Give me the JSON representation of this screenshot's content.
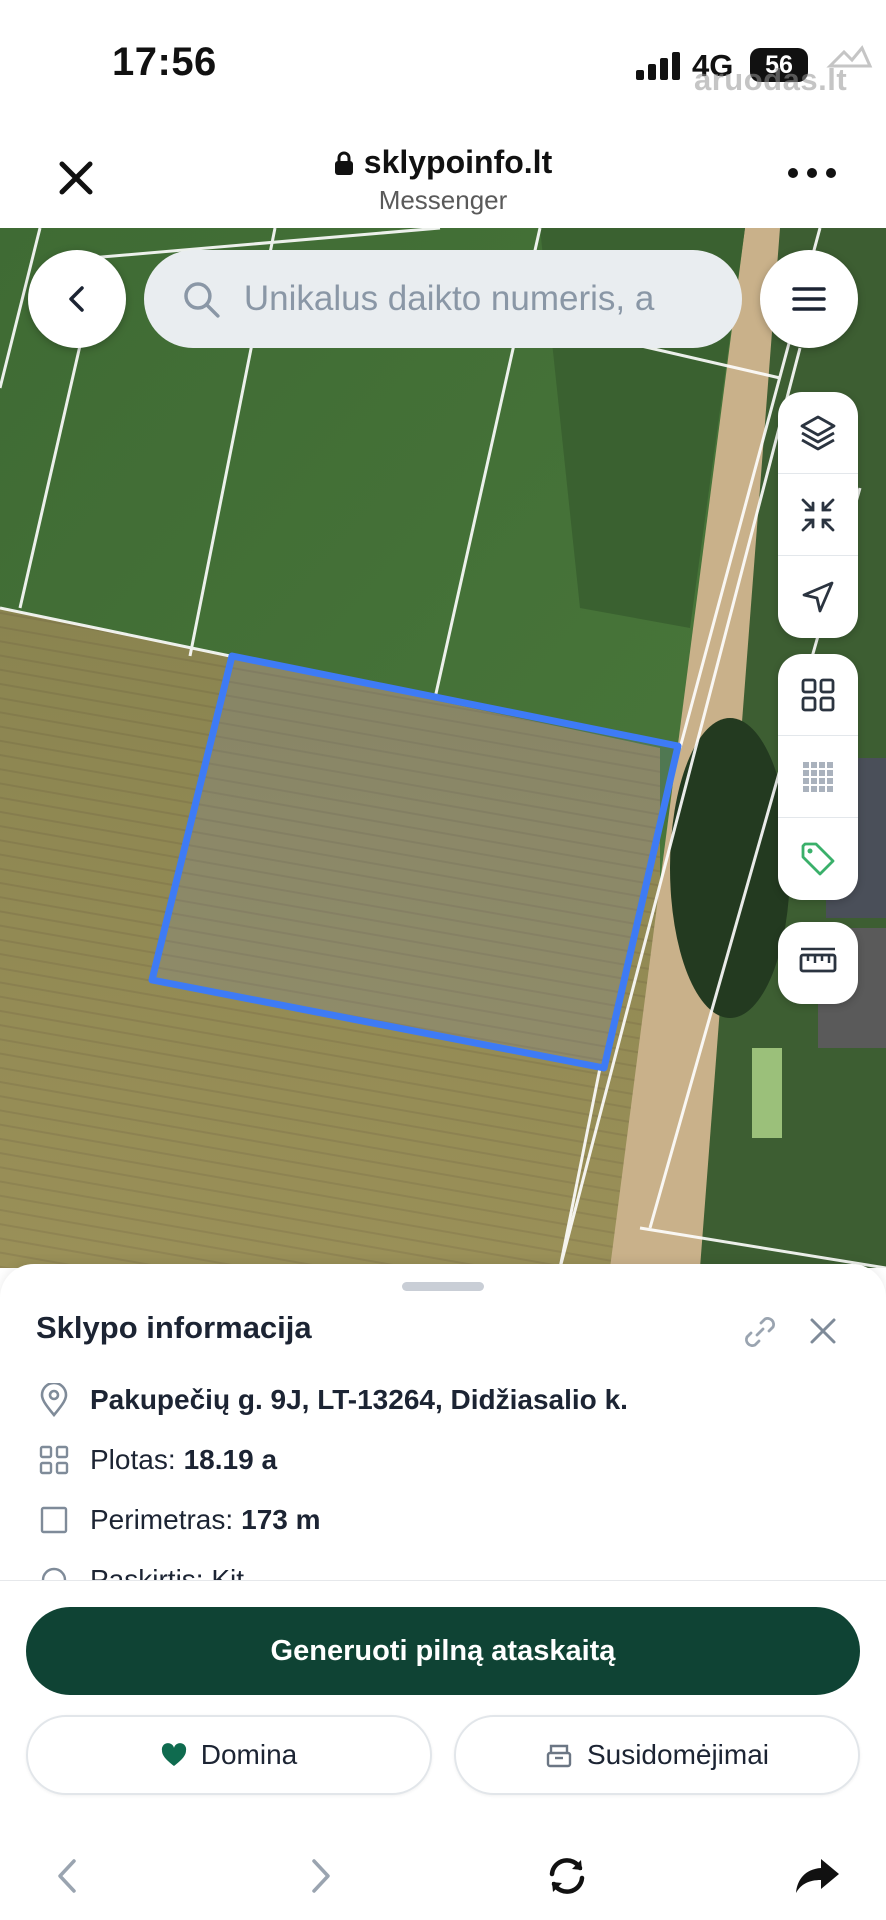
{
  "status_bar": {
    "time": "17:56",
    "network": "4G",
    "battery": "56",
    "watermark": "aruodas.lt"
  },
  "browser": {
    "url": "sklypoinfo.lt",
    "subtitle": "Messenger",
    "icons": [
      "close-icon",
      "lock-icon",
      "more-icon"
    ]
  },
  "map": {
    "search": {
      "placeholder": "Unikalus daikto numeris, a"
    },
    "tools": [
      "layers-icon",
      "collapse-icon",
      "navigate-icon",
      "grid-icon",
      "parcels-grid-icon",
      "tag-icon",
      "ruler-icon"
    ],
    "accent_color": "#3e7bf5"
  },
  "sheet": {
    "title": "Sklypo informacija",
    "address": "Pakupečių g. 9J, LT-13264, Didžiasalio k.",
    "area_label": "Plotas:",
    "area_value": "18.19 a",
    "perimeter_label": "Perimetras:",
    "perimeter_value": "173 m",
    "partial_label": "Paskirtis: Kit"
  },
  "actions": {
    "primary_label": "Generuoti pilną ataskaitą",
    "like_label": "Domina",
    "interests_label": "Susidomėjimai",
    "primary_color": "#0f4334",
    "heart_color": "#0f6b4f"
  }
}
